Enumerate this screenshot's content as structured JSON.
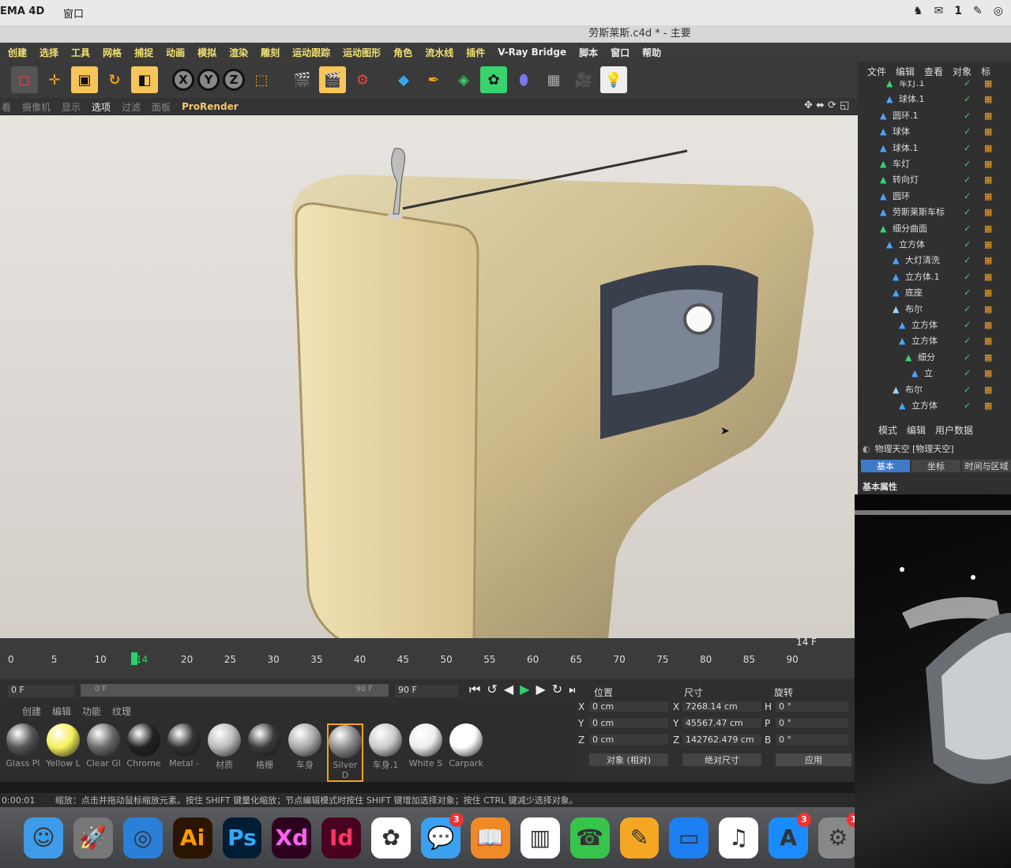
{
  "mac_menubar": {
    "app": "EMA 4D",
    "window_menu": "窗口",
    "notification_count": "1"
  },
  "title": "劳斯莱斯.c4d * - 主要",
  "menu": [
    "创建",
    "选择",
    "工具",
    "网格",
    "捕捉",
    "动画",
    "模拟",
    "渲染",
    "雕刻",
    "运动跟踪",
    "运动图形",
    "角色",
    "流水线",
    "插件",
    "V-Ray Bridge",
    "脚本",
    "窗口",
    "帮助"
  ],
  "axis_buttons": [
    "X",
    "Y",
    "Z"
  ],
  "viewport_menu": [
    "看",
    "摄像机",
    "显示",
    "选项",
    "过滤",
    "面板",
    "ProRender"
  ],
  "timeline": {
    "ticks": [
      "0",
      "5",
      "10",
      "14",
      "20",
      "25",
      "30",
      "35",
      "40",
      "45",
      "50",
      "55",
      "60",
      "65",
      "70",
      "75",
      "80",
      "85",
      "90"
    ],
    "current_frame": "14",
    "frame_display": "14 F",
    "start_field": "0 F",
    "range_start": "0 F",
    "range_end": "90 F",
    "end_field": "90 F"
  },
  "materials": {
    "menu": [
      "创建",
      "编辑",
      "功能",
      "纹理"
    ],
    "items": [
      {
        "label": "Glass Pl",
        "color": "#555"
      },
      {
        "label": "Yellow L",
        "color": "#f4f05a"
      },
      {
        "label": "Clear Gl",
        "color": "#6a6a6a"
      },
      {
        "label": "Chrome",
        "color": "#222"
      },
      {
        "label": "Metal -",
        "color": "#333"
      },
      {
        "label": "材质",
        "color": "#bbb"
      },
      {
        "label": "格栅",
        "color": "#3a3a3a"
      },
      {
        "label": "车身",
        "color": "#aaa"
      },
      {
        "label": "Silver D",
        "color": "#888"
      },
      {
        "label": "车身.1",
        "color": "#ccc"
      },
      {
        "label": "White S",
        "color": "#eee"
      },
      {
        "label": "Carpark",
        "color": "#fff"
      }
    ]
  },
  "coords": {
    "headers": [
      "位置",
      "尺寸",
      "旋转"
    ],
    "rows": [
      {
        "axis": "X",
        "pos": "0 cm",
        "size_axis": "X",
        "size": "7268.14 cm",
        "rot_axis": "H",
        "rot": "0 °"
      },
      {
        "axis": "Y",
        "pos": "0 cm",
        "size_axis": "Y",
        "size": "45567.47 cm",
        "rot_axis": "P",
        "rot": "0 °"
      },
      {
        "axis": "Z",
        "pos": "0 cm",
        "size_axis": "Z",
        "size": "142762.479 cm",
        "rot_axis": "B",
        "rot": "0 °"
      }
    ],
    "mode1": "对象 (相对)",
    "mode2": "绝对尺寸",
    "apply": "应用"
  },
  "status": {
    "time": "0:00:01",
    "text": "缩放：点击并拖动鼠标缩放元素。按住 SHIFT 键量化缩放；节点编辑模式时按住 SHIFT 键增加选择对象；按住 CTRL 键减少选择对象。"
  },
  "object_manager": {
    "menu": [
      "文件",
      "编辑",
      "查看",
      "对象",
      "标"
    ],
    "objects": [
      "车灯.1",
      "球体.1",
      "圆环.1",
      "球体",
      "球体.1",
      "车灯",
      "转向灯",
      "圆环",
      "劳斯莱斯车标",
      "细分曲面",
      "立方体",
      "大灯清洗",
      "立方体.1",
      "底座",
      "布尔",
      "立方体",
      "立方体",
      "细分",
      "立",
      "布尔",
      "立方体"
    ]
  },
  "attributes": {
    "menu": [
      "模式",
      "编辑",
      "用户数据"
    ],
    "object": "物理天空 [物理天空]",
    "tabs": [
      "基本",
      "坐标",
      "时间与区域"
    ],
    "section": "基本属性"
  },
  "dock": [
    {
      "name": "finder",
      "label": "☺",
      "bg": "#3d9be9"
    },
    {
      "name": "launchpad",
      "label": "🚀",
      "bg": "#777"
    },
    {
      "name": "safari",
      "label": "◎",
      "bg": "#2a7fd6"
    },
    {
      "name": "illustrator",
      "label": "Ai",
      "bg": "#2b1500",
      "fg": "#ff9a00"
    },
    {
      "name": "photoshop",
      "label": "Ps",
      "bg": "#001d34",
      "fg": "#31a8ff"
    },
    {
      "name": "xd",
      "label": "Xd",
      "bg": "#2e001f",
      "fg": "#ff61f6"
    },
    {
      "name": "indesign",
      "label": "Id",
      "bg": "#49021f",
      "fg": "#ff3366"
    },
    {
      "name": "photos",
      "label": "✿",
      "bg": "#fff"
    },
    {
      "name": "messages",
      "label": "💬",
      "bg": "#3aa0f0",
      "badge": "3"
    },
    {
      "name": "ibooks",
      "label": "📖",
      "bg": "#f08a24"
    },
    {
      "name": "numbers",
      "label": "▥",
      "bg": "#fff"
    },
    {
      "name": "facetime",
      "label": "☎",
      "bg": "#37c44b"
    },
    {
      "name": "pages",
      "label": "✎",
      "bg": "#f5a623"
    },
    {
      "name": "keynote",
      "label": "▭",
      "bg": "#1c7ff2"
    },
    {
      "name": "itunes",
      "label": "♫",
      "bg": "#fff"
    },
    {
      "name": "appstore",
      "label": "A",
      "bg": "#1a8cff",
      "badge": "3"
    },
    {
      "name": "preferences",
      "label": "⚙",
      "bg": "#888",
      "badge": "1"
    }
  ]
}
